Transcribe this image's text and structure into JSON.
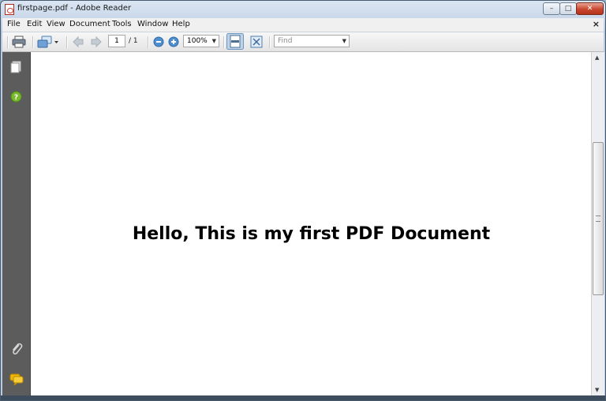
{
  "window": {
    "title": "firstpage.pdf - Adobe Reader",
    "minimize": "–",
    "maximize": "□",
    "close": "✕"
  },
  "menubar": {
    "items": [
      "File",
      "Edit",
      "View",
      "Document",
      "Tools",
      "Window",
      "Help"
    ],
    "close": "×"
  },
  "toolbar": {
    "page_current": "1",
    "page_total": "/ 1",
    "zoom": "100%",
    "find_placeholder": "Find",
    "icons": [
      "printer-icon",
      "collaborate-icon",
      "previous-page-icon",
      "next-page-icon",
      "zoom-out-icon",
      "zoom-in-icon",
      "fit-page-icon",
      "full-screen-icon"
    ]
  },
  "sidebar": {
    "icons": [
      "pages-icon",
      "help-icon",
      "attachments-icon",
      "comments-icon"
    ]
  },
  "document": {
    "text": "Hello, This is my first PDF Document"
  },
  "colors": {
    "sidebar": "#5c5c5c",
    "titlebar": "#c9d8ea",
    "close_button": "#c9462d",
    "help_icon": "#7ab82e"
  }
}
